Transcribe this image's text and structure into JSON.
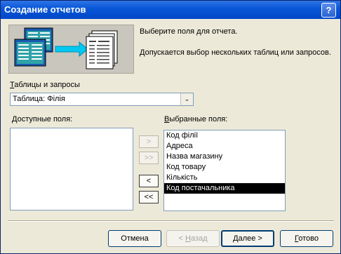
{
  "window": {
    "title": "Создание отчетов",
    "help_label": "?"
  },
  "intro": {
    "line1": "Выберите поля для отчета.",
    "line2": "Допускается выбор нескольких таблиц или запросов."
  },
  "tables": {
    "label_first": "Т",
    "label_rest": "аблицы и запросы",
    "selected": "Таблица: Філія",
    "dropdown_glyph": "⌄"
  },
  "available": {
    "label_first": "Д",
    "label_rest": "оступные поля:",
    "items": []
  },
  "selected_fields": {
    "label_first": "В",
    "label_rest": "ыбранные поля:",
    "items": [
      "Код філії",
      "Адреса",
      "Назва магазину",
      "Код товару",
      "Кількість",
      "Код постачальника"
    ],
    "selected_index": 5
  },
  "move_buttons": {
    "add_one": ">",
    "add_all": ">>",
    "remove_one": "<",
    "remove_all": "<<"
  },
  "footer": {
    "cancel": "Отмена",
    "back_prefix": "< ",
    "back_first": "Н",
    "back_rest": "азад",
    "next_first": "Д",
    "next_rest": "алее >",
    "finish_first": "Г",
    "finish_rest": "отово"
  }
}
